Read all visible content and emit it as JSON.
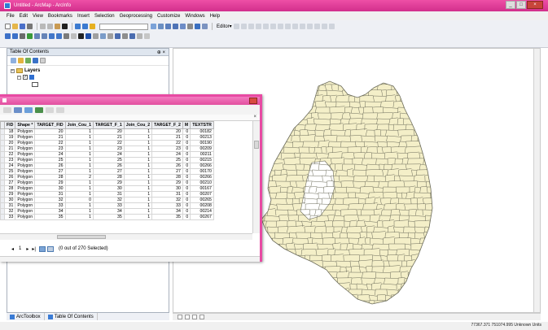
{
  "window": {
    "title": "Untitled - ArcMap - ArcInfo"
  },
  "menu": [
    "File",
    "Edit",
    "View",
    "Bookmarks",
    "Insert",
    "Selection",
    "Geoprocessing",
    "Customize",
    "Windows",
    "Help"
  ],
  "toolbar": {
    "editor_label": "Editor▾"
  },
  "toc": {
    "title": "Table Of Contents",
    "pin": "⊕ ×",
    "layers_label": "Layers"
  },
  "attribute_table": {
    "columns": [
      "FID",
      "Shape *",
      "TARGET_FID",
      "Join_Cou_1",
      "TARGET_F_1",
      "Join_Cou_2",
      "TARGET_F_2",
      "M",
      "TEXTSTR"
    ],
    "rows": [
      [
        "18",
        "Polygon",
        "20",
        "1",
        "20",
        "1",
        "20",
        "0",
        "00182"
      ],
      [
        "19",
        "Polygon",
        "21",
        "1",
        "21",
        "1",
        "21",
        "0",
        "00213"
      ],
      [
        "20",
        "Polygon",
        "22",
        "1",
        "22",
        "1",
        "22",
        "0",
        "00190"
      ],
      [
        "21",
        "Polygon",
        "23",
        "1",
        "23",
        "1",
        "23",
        "0",
        "00209"
      ],
      [
        "22",
        "Polygon",
        "24",
        "1",
        "24",
        "1",
        "24",
        "0",
        "00211"
      ],
      [
        "23",
        "Polygon",
        "25",
        "1",
        "25",
        "1",
        "25",
        "0",
        "00215"
      ],
      [
        "24",
        "Polygon",
        "26",
        "1",
        "26",
        "1",
        "26",
        "0",
        "00266"
      ],
      [
        "25",
        "Polygon",
        "27",
        "1",
        "27",
        "1",
        "27",
        "0",
        "00170"
      ],
      [
        "26",
        "Polygon",
        "28",
        "2",
        "28",
        "1",
        "28",
        "0",
        "00266"
      ],
      [
        "27",
        "Polygon",
        "29",
        "1",
        "29",
        "1",
        "29",
        "0",
        "00210"
      ],
      [
        "28",
        "Polygon",
        "30",
        "1",
        "30",
        "1",
        "30",
        "0",
        "00167"
      ],
      [
        "29",
        "Polygon",
        "31",
        "1",
        "31",
        "1",
        "31",
        "0",
        "00207"
      ],
      [
        "30",
        "Polygon",
        "32",
        "0",
        "32",
        "1",
        "32",
        "0",
        "00265"
      ],
      [
        "31",
        "Polygon",
        "33",
        "1",
        "33",
        "1",
        "33",
        "0",
        "00208"
      ],
      [
        "32",
        "Polygon",
        "34",
        "1",
        "34",
        "1",
        "34",
        "0",
        "00214"
      ],
      [
        "33",
        "Polygon",
        "35",
        "1",
        "35",
        "1",
        "35",
        "0",
        "00267"
      ]
    ],
    "page_current": "1",
    "selection_text": "(0 out of 270 Selected)"
  },
  "tabs": [
    {
      "label": "ArcToolbox"
    },
    {
      "label": "Table Of Contents"
    }
  ],
  "status": {
    "coords": "77367.371 751074.995 Unknown Units"
  },
  "colors": {
    "title_bar": "#e43f9a",
    "parcel_fill": "#f4efc8",
    "parcel_stroke": "#6b6b5a"
  }
}
